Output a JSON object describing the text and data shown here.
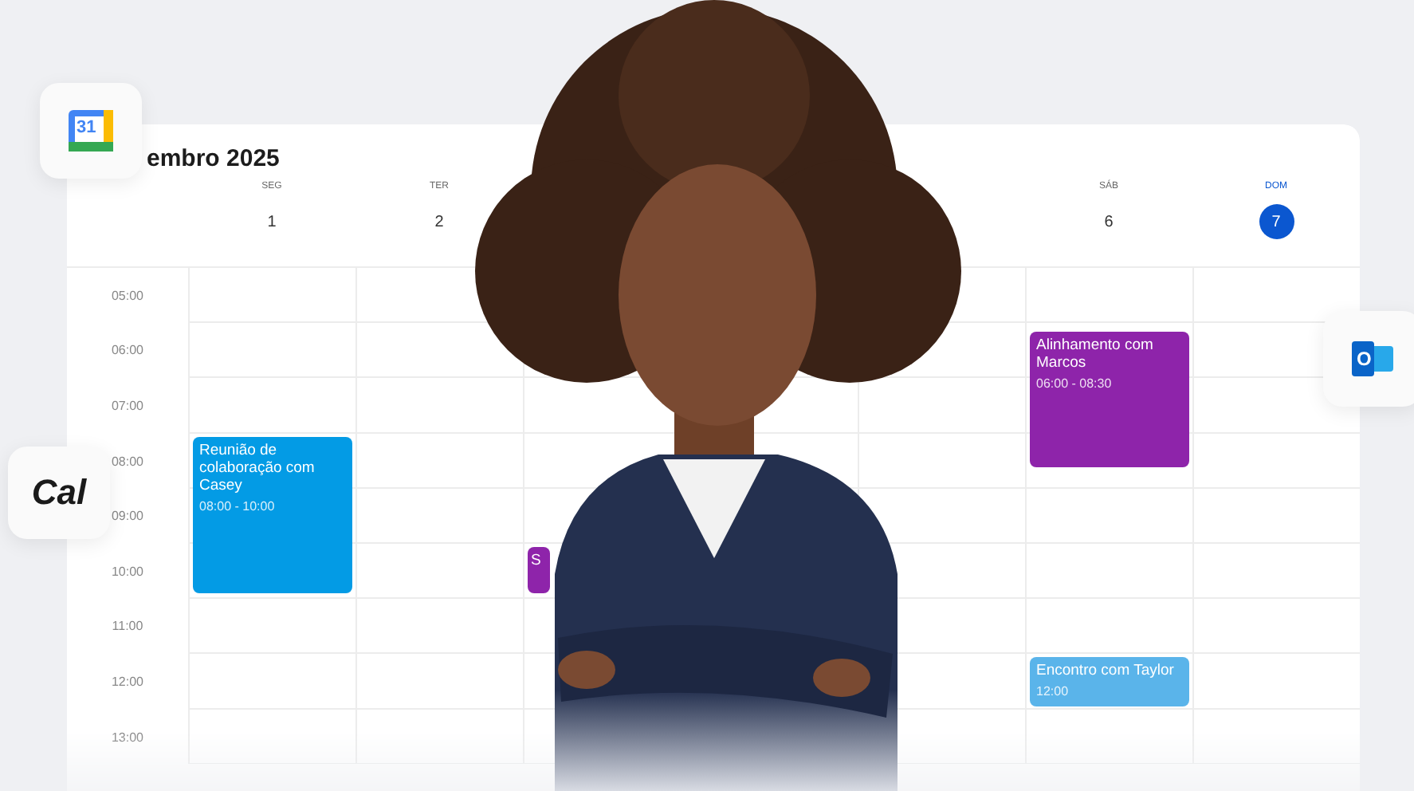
{
  "floating_apps": [
    {
      "kind": "calendar",
      "label": "31"
    },
    {
      "kind": "wordmark",
      "label": "Cal"
    },
    {
      "kind": "mail",
      "label": "O"
    }
  ],
  "calendar": {
    "title": "embro 2025",
    "hours": [
      "05:00",
      "06:00",
      "07:00",
      "08:00",
      "09:00",
      "10:00",
      "11:00",
      "12:00",
      "13:00"
    ],
    "days": [
      {
        "weekday": "SEG",
        "date": "1",
        "today": false,
        "events": [
          {
            "title": "Reunião de colaboração com Casey",
            "time": "08:00 - 10:00",
            "kind": "tall",
            "color": "#039be5"
          }
        ]
      },
      {
        "weekday": "TER",
        "date": "2",
        "today": false
      },
      {
        "covered": true,
        "events": [
          {
            "title": "S",
            "kind": "peek",
            "color": "#8e24aa"
          }
        ]
      },
      {
        "covered": true
      },
      {
        "covered": true
      },
      {
        "weekday": "SÁB",
        "date": "6",
        "today": false,
        "events": [
          {
            "title": "Alinhamento com Marcos",
            "time": "06:00 - 08:30",
            "kind": "medium",
            "color": "#8e24aa"
          },
          {
            "title": "Encontro com Taylor",
            "time": "12:00",
            "kind": "short",
            "color": "#5ab4ea"
          }
        ]
      },
      {
        "weekday": "DOM",
        "date": "7",
        "today": true
      }
    ]
  }
}
